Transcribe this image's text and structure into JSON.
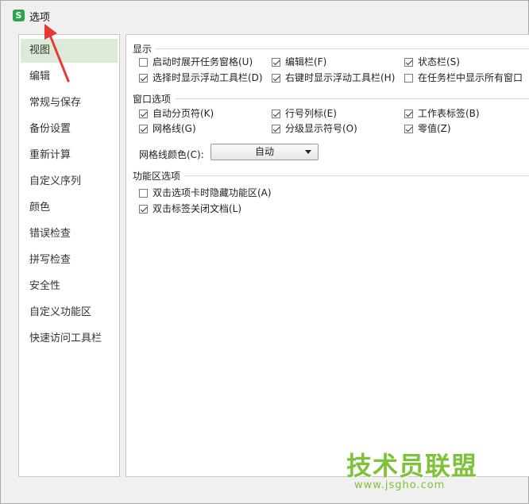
{
  "window": {
    "title": "选项",
    "app_icon": "S"
  },
  "sidebar": {
    "items": [
      {
        "label": "视图",
        "active": true
      },
      {
        "label": "编辑"
      },
      {
        "label": "常规与保存"
      },
      {
        "label": "备份设置"
      },
      {
        "label": "重新计算"
      },
      {
        "label": "自定义序列"
      },
      {
        "label": "颜色"
      },
      {
        "label": "错误检查"
      },
      {
        "label": "拼写检查"
      },
      {
        "label": "安全性"
      },
      {
        "label": "自定义功能区"
      },
      {
        "label": "快速访问工具栏"
      }
    ]
  },
  "display": {
    "title": "显示",
    "options": [
      {
        "label": "启动时展开任务窗格(U)",
        "checked": false
      },
      {
        "label": "编辑栏(F)",
        "checked": true
      },
      {
        "label": "状态栏(S)",
        "checked": true
      },
      {
        "label": "选择时显示浮动工具栏(D)",
        "checked": true
      },
      {
        "label": "右键时显示浮动工具栏(H)",
        "checked": true
      },
      {
        "label": "在任务栏中显示所有窗口",
        "checked": false
      }
    ]
  },
  "window_options": {
    "title": "窗口选项",
    "options": [
      {
        "label": "自动分页符(K)",
        "checked": true
      },
      {
        "label": "行号列标(E)",
        "checked": true
      },
      {
        "label": "工作表标签(B)",
        "checked": true
      },
      {
        "label": "网格线(G)",
        "checked": true
      },
      {
        "label": "分级显示符号(O)",
        "checked": true
      },
      {
        "label": "零值(Z)",
        "checked": true
      }
    ],
    "grid_color_label": "网格线颜色(C):",
    "grid_color_value": "自动"
  },
  "ribbon": {
    "title": "功能区选项",
    "options": [
      {
        "label": "双击选项卡时隐藏功能区(A)",
        "checked": false
      },
      {
        "label": "双击标签关闭文档(L)",
        "checked": true
      }
    ]
  },
  "watermark": {
    "title": "技术员联盟",
    "url": "www.jsgho.com"
  },
  "colors": {
    "accent": "#2ea44f",
    "selected": "#dcebd8",
    "annotation": "#e53935",
    "watermark": "#7ec23a"
  }
}
